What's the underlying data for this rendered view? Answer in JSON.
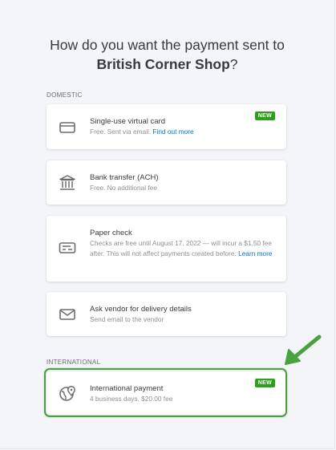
{
  "header": {
    "title_line1": "How do you want the payment sent to",
    "vendor_name": "British Corner Shop",
    "title_suffix": "?"
  },
  "sections": {
    "domestic_label": "DOMESTIC",
    "international_label": "INTERNATIONAL"
  },
  "options": {
    "virtual_card": {
      "name": "Single-use virtual card",
      "desc": "Free. Sent via email.",
      "link": "Find out more",
      "badge": "NEW",
      "icon": "credit-card-icon"
    },
    "ach": {
      "name": "Bank transfer (ACH)",
      "desc": "Free. No additional fee",
      "icon": "bank-icon"
    },
    "check": {
      "name": "Paper check",
      "desc": "Checks are free until August 17, 2022 — will incur a $1.50 fee after. This will not affect payments created before.",
      "link": "Learn more",
      "icon": "check-icon"
    },
    "ask_vendor": {
      "name": "Ask vendor for delivery details",
      "desc": "Send email to the vendor",
      "icon": "envelope-icon"
    },
    "international": {
      "name": "International payment",
      "desc": "4 business days. $20.00 fee",
      "badge": "NEW",
      "icon": "globe-icon"
    }
  },
  "colors": {
    "background": "#f4f5f8",
    "badge_green": "#2ca01c",
    "link_blue": "#0077c5",
    "highlight_green": "#48a23f"
  }
}
